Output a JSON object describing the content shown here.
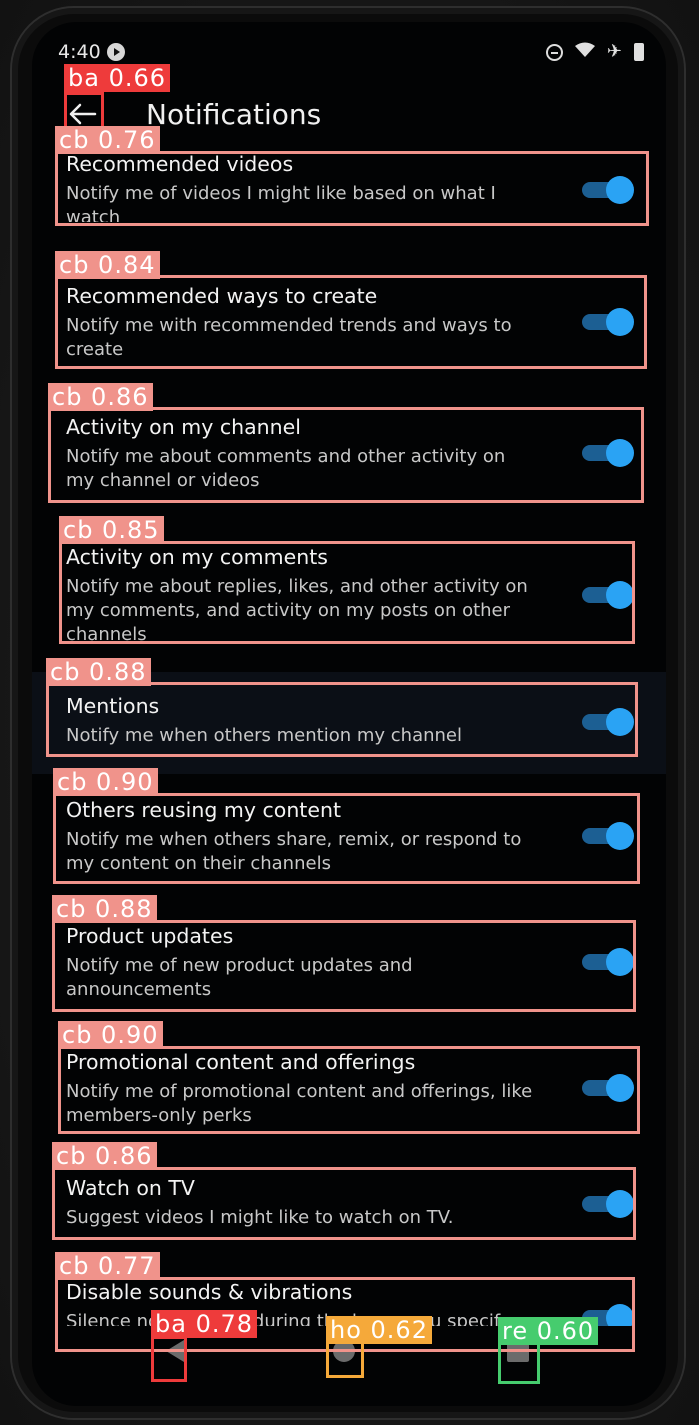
{
  "status_bar": {
    "time": "4:40"
  },
  "app_bar": {
    "title": "Notifications"
  },
  "settings": [
    {
      "title": "Recommended videos",
      "desc": "Notify me of videos I might like based on what I watch",
      "enabled": true
    },
    {
      "title": "Recommended ways to create",
      "desc": "Notify me with recommended trends and ways to create",
      "enabled": true
    },
    {
      "title": "Activity on my channel",
      "desc": "Notify me about comments and other activity on my channel or videos",
      "enabled": true
    },
    {
      "title": "Activity on my comments",
      "desc": "Notify me about replies, likes, and other activity on my comments, and activity on my posts on other channels",
      "enabled": true
    },
    {
      "title": "Mentions",
      "desc": "Notify me when others mention my channel",
      "enabled": true
    },
    {
      "title": "Others reusing my content",
      "desc": "Notify me when others share, remix, or respond to my content on their channels",
      "enabled": true
    },
    {
      "title": "Product updates",
      "desc": "Notify me of new product updates and announcements",
      "enabled": true
    },
    {
      "title": "Promotional content and offerings",
      "desc": "Notify me of promotional content and offerings, like members-only perks",
      "enabled": true
    },
    {
      "title": "Watch on TV",
      "desc": "Suggest videos I might like to watch on TV.",
      "enabled": true
    },
    {
      "title": "Disable sounds & vibrations",
      "desc": "Silence notifications during the hours you specify",
      "enabled": true
    }
  ],
  "detections": [
    {
      "label": "ba 0.66",
      "cls": "ba"
    },
    {
      "label": "cb 0.76",
      "cls": "cb"
    },
    {
      "label": "cb 0.84",
      "cls": "cb"
    },
    {
      "label": "cb 0.86",
      "cls": "cb"
    },
    {
      "label": "cb 0.85",
      "cls": "cb"
    },
    {
      "label": "cb 0.88",
      "cls": "cb"
    },
    {
      "label": "cb 0.90",
      "cls": "cb"
    },
    {
      "label": "cb 0.88",
      "cls": "cb"
    },
    {
      "label": "cb 0.90",
      "cls": "cb"
    },
    {
      "label": "cb 0.86",
      "cls": "cb"
    },
    {
      "label": "cb 0.77",
      "cls": "cb"
    },
    {
      "label": "ba 0.78",
      "cls": "ba"
    },
    {
      "label": "ho 0.62",
      "cls": "ho"
    },
    {
      "label": "re 0.60",
      "cls": "re"
    }
  ],
  "colors": {
    "toggle_on_knob": "#2aa3f4",
    "toggle_on_track": "#1c5f93",
    "cb_box": "#f0938b",
    "ba_box": "#ee3b3b",
    "ho_box": "#f5a93a",
    "re_box": "#46cc6e"
  }
}
